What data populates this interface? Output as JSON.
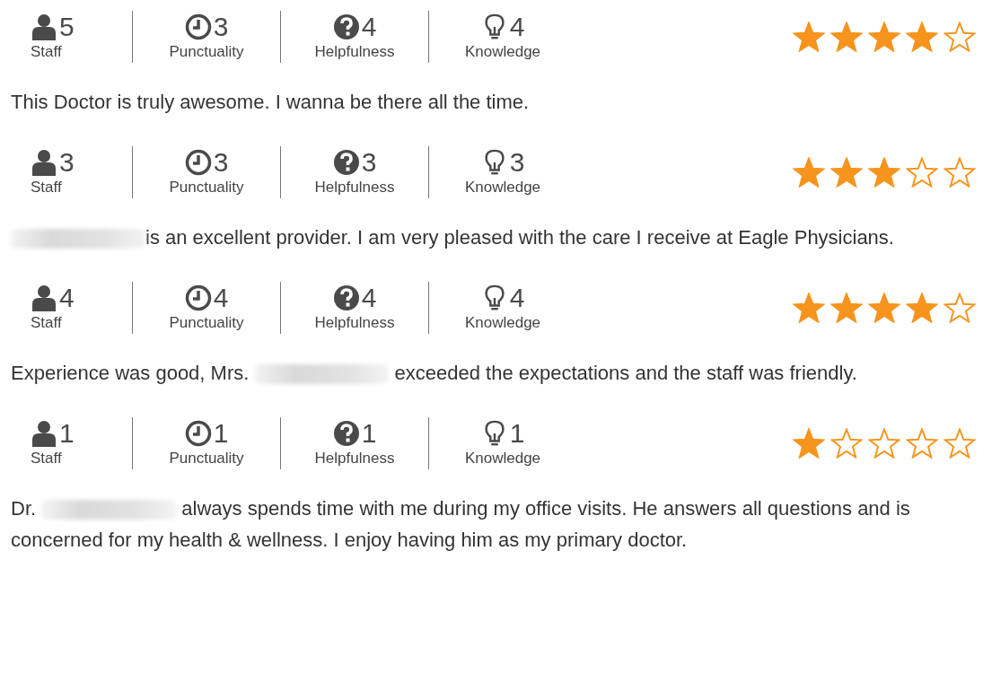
{
  "reviews": [
    {
      "metrics": [
        {
          "kind": "staff",
          "value": "5",
          "label": "Staff"
        },
        {
          "kind": "punctuality",
          "value": "3",
          "label": "Punctuality"
        },
        {
          "kind": "helpfulness",
          "value": "4",
          "label": "Helpfulness"
        },
        {
          "kind": "knowledge",
          "value": "4",
          "label": "Knowledge"
        }
      ],
      "stars": 4,
      "text": [
        {
          "kind": "text",
          "text": "This Doctor is truly awesome. I wanna be there all the time."
        }
      ]
    },
    {
      "metrics": [
        {
          "kind": "staff",
          "value": "3",
          "label": "Staff"
        },
        {
          "kind": "punctuality",
          "value": "3",
          "label": "Punctuality"
        },
        {
          "kind": "helpfulness",
          "value": "3",
          "label": "Helpfulness"
        },
        {
          "kind": "knowledge",
          "value": "3",
          "label": "Knowledge"
        }
      ],
      "stars": 3,
      "text": [
        {
          "kind": "redaction"
        },
        {
          "kind": "text",
          "text": "is an excellent provider. I am very pleased with the care I receive at Eagle Physicians."
        }
      ]
    },
    {
      "metrics": [
        {
          "kind": "staff",
          "value": "4",
          "label": "Staff"
        },
        {
          "kind": "punctuality",
          "value": "4",
          "label": "Punctuality"
        },
        {
          "kind": "helpfulness",
          "value": "4",
          "label": "Helpfulness"
        },
        {
          "kind": "knowledge",
          "value": "4",
          "label": "Knowledge"
        }
      ],
      "stars": 4,
      "text": [
        {
          "kind": "text",
          "text": "Experience was good, Mrs. "
        },
        {
          "kind": "redaction"
        },
        {
          "kind": "text",
          "text": " exceeded the expectations and the staff was friendly."
        }
      ]
    },
    {
      "metrics": [
        {
          "kind": "staff",
          "value": "1",
          "label": "Staff"
        },
        {
          "kind": "punctuality",
          "value": "1",
          "label": "Punctuality"
        },
        {
          "kind": "helpfulness",
          "value": "1",
          "label": "Helpfulness"
        },
        {
          "kind": "knowledge",
          "value": "1",
          "label": "Knowledge"
        }
      ],
      "stars": 1,
      "text": [
        {
          "kind": "text",
          "text": "Dr. "
        },
        {
          "kind": "redaction"
        },
        {
          "kind": "text",
          "text": " always spends time with me during my office visits. He answers all questions and is concerned for my health & wellness. I enjoy having him as my primary doctor."
        }
      ]
    }
  ]
}
